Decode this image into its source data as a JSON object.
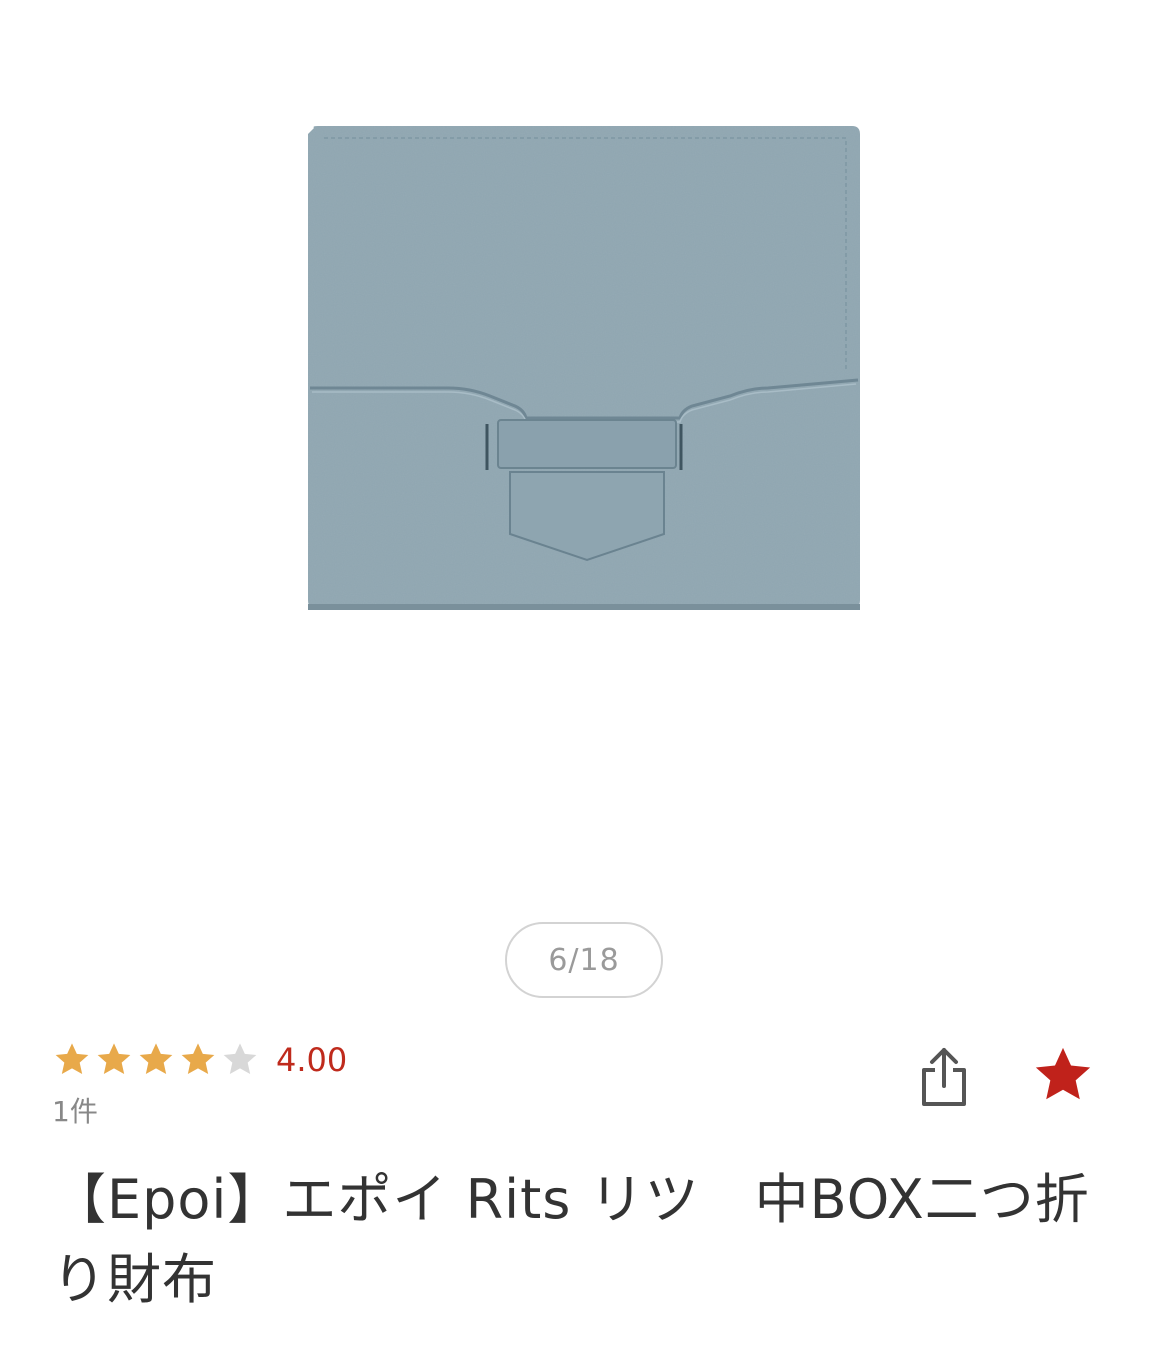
{
  "gallery": {
    "counter": "6/18",
    "image_alt": "wallet"
  },
  "rating": {
    "stars_filled": 4,
    "stars_total": 5,
    "value": "4.00",
    "review_count": "1件"
  },
  "actions": {
    "share_icon": "share-icon",
    "favorite_icon": "star-icon"
  },
  "product": {
    "title": "【Epoi】エポイ Rits リツ　中BOX二つ折り財布"
  },
  "colors": {
    "star_filled": "#e8a94a",
    "star_empty": "#d8d8d8",
    "rating_text": "#bf2a1c",
    "favorite": "#c0221b",
    "wallet": "#8fa6b1"
  }
}
